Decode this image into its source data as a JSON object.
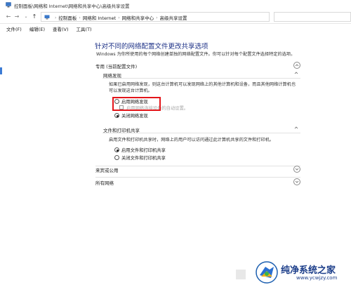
{
  "window": {
    "title": "控制面板\\网络和 Internet\\网络和共享中心\\高级共享设置"
  },
  "address": {
    "crumbs": [
      "控制面板",
      "网络和 Internet",
      "网络和共享中心",
      "高级共享设置"
    ]
  },
  "menu": {
    "items": [
      "文件(F)",
      "编辑(E)",
      "查看(V)",
      "工具(T)"
    ]
  },
  "main": {
    "heading": "针对不同的网络配置文件更改共享选项",
    "description": "Windows 为你所使用的每个网络创建单独的网络配置文件。你可以针对每个配置文件选择特定的选项。"
  },
  "private_profile": {
    "label": "专用 (当前配置文件)",
    "network_discovery": {
      "title": "网络发现",
      "description_line1": "如果已启用网络发现，则这台计算机可以发现网络上的其他计算机和设备，而且其他网络计算机也",
      "description_line2": "可以发现这台计算机。",
      "option_on": "启用网络发现",
      "auto_setup": "启用网络连接设备的自动设置。",
      "option_off": "关闭网络发现",
      "selected": "off"
    },
    "file_printer_sharing": {
      "title": "文件和打印机共享",
      "description": "启用文件和打印机共享时，网络上的用户可以访问通过此计算机共享的文件和打印机。",
      "option_on": "启用文件和打印机共享",
      "option_off": "关闭文件和打印机共享",
      "selected": "on"
    }
  },
  "guest_profile": {
    "label": "来宾或公用"
  },
  "all_networks": {
    "label": "所有网络"
  },
  "watermark": {
    "text": "纯净系统之家",
    "url": "www.ycwjzy.com"
  }
}
